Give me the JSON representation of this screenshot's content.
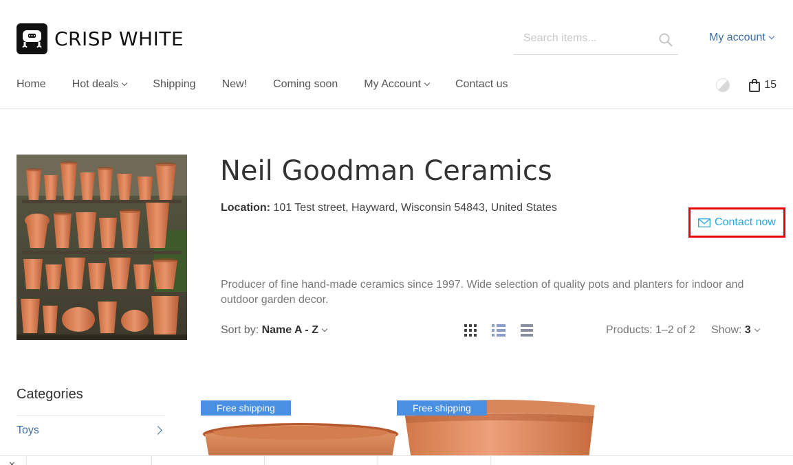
{
  "header": {
    "logo_text": "CRISP WHITE",
    "search_placeholder": "Search items...",
    "account_label": "My account"
  },
  "nav": {
    "items": [
      {
        "label": "Home"
      },
      {
        "label": "Hot deals",
        "dropdown": true
      },
      {
        "label": "Shipping"
      },
      {
        "label": "New!"
      },
      {
        "label": "Coming soon"
      },
      {
        "label": "My Account",
        "dropdown": true
      },
      {
        "label": "Contact us"
      }
    ],
    "cart_count": "15"
  },
  "vendor": {
    "title": "Neil Goodman Ceramics",
    "location_label": "Location:",
    "location_value": "101 Test street, Hayward, Wisconsin 54843, United States",
    "contact_label": "Contact now",
    "description": "Producer of fine hand-made ceramics since 1997. Wide selection of quality pots and planters for indoor and outdoor garden decor."
  },
  "toolbar": {
    "sort_label": "Sort by:",
    "sort_value": "Name A - Z",
    "products_count": "Products: 1–2 of 2",
    "show_label": "Show:",
    "show_value": "3"
  },
  "sidebar": {
    "title": "Categories",
    "items": [
      {
        "label": "Toys"
      }
    ]
  },
  "products": [
    {
      "badge": "Free shipping"
    },
    {
      "badge": "Free shipping"
    }
  ],
  "colors": {
    "link": "#3b6fa6",
    "contact": "#2aa6d9",
    "highlight": "#e60000",
    "badge": "#4a90e2",
    "terracotta": "#d97a4a"
  }
}
